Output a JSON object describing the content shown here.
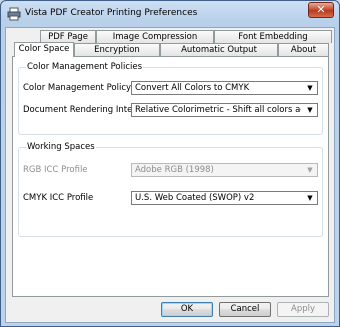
{
  "window": {
    "title": "Vista PDF Creator Printing Preferences",
    "close_glyph": "✕",
    "icon": "printer-icon"
  },
  "tabs_row1": [
    {
      "label": "PDF Page"
    },
    {
      "label": "Image Compression"
    },
    {
      "label": "Font Embedding"
    }
  ],
  "tabs_row2": [
    {
      "label": "Color Space",
      "active": true
    },
    {
      "label": "Encryption"
    },
    {
      "label": "Automatic Output"
    },
    {
      "label": "About"
    }
  ],
  "color_management": {
    "group_title": "Color Management Policies",
    "policy_label": "Color Management Policy",
    "policy_value": "Convert All Colors to CMYK",
    "intent_label": "Document Rendering Intent",
    "intent_value": "Relative Colorimetric - Shift all colors accordingly a"
  },
  "working_spaces": {
    "group_title": "Working Spaces",
    "rgb_label": "RGB ICC Profile",
    "rgb_value": "Adobe RGB (1998)",
    "cmyk_label": "CMYK ICC Profile",
    "cmyk_value": "U.S. Web Coated (SWOP) v2"
  },
  "buttons": {
    "ok": "OK",
    "cancel": "Cancel",
    "apply": "Apply"
  },
  "dropdown_arrow": "▼"
}
